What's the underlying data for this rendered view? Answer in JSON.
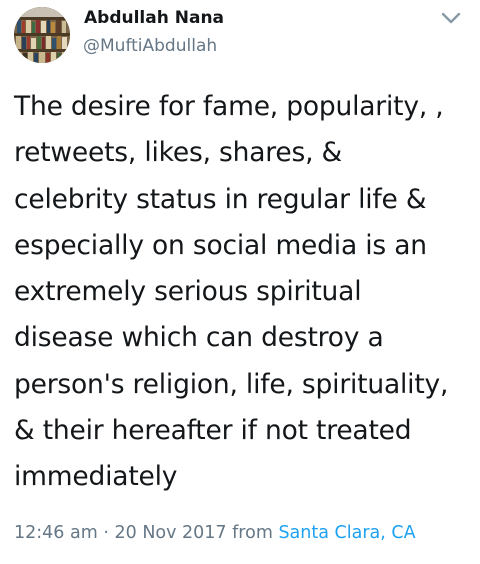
{
  "author": {
    "name": "Abdullah Nana",
    "handle": "@MuftiAbdullah",
    "avatar_icon": "bookshelf-avatar-icon"
  },
  "menu_icon": "chevron-down-icon",
  "tweet": {
    "lines": [
      "The desire for fame, popularity, ,",
      "retweets, likes, shares, &",
      "celebrity status in regular life &",
      "especially on social media is an",
      "extremely serious spiritual",
      "disease which can destroy a",
      "person's religion, life, spirituality,",
      "& their hereafter if not treated",
      "immediately"
    ]
  },
  "meta": {
    "time": "12:46 am",
    "separator": " · ",
    "date": "20 Nov 2017",
    "from_label": " from ",
    "location": "Santa Clara, CA"
  },
  "colors": {
    "text": "#14171a",
    "secondary": "#657786",
    "link": "#1da1f2"
  }
}
